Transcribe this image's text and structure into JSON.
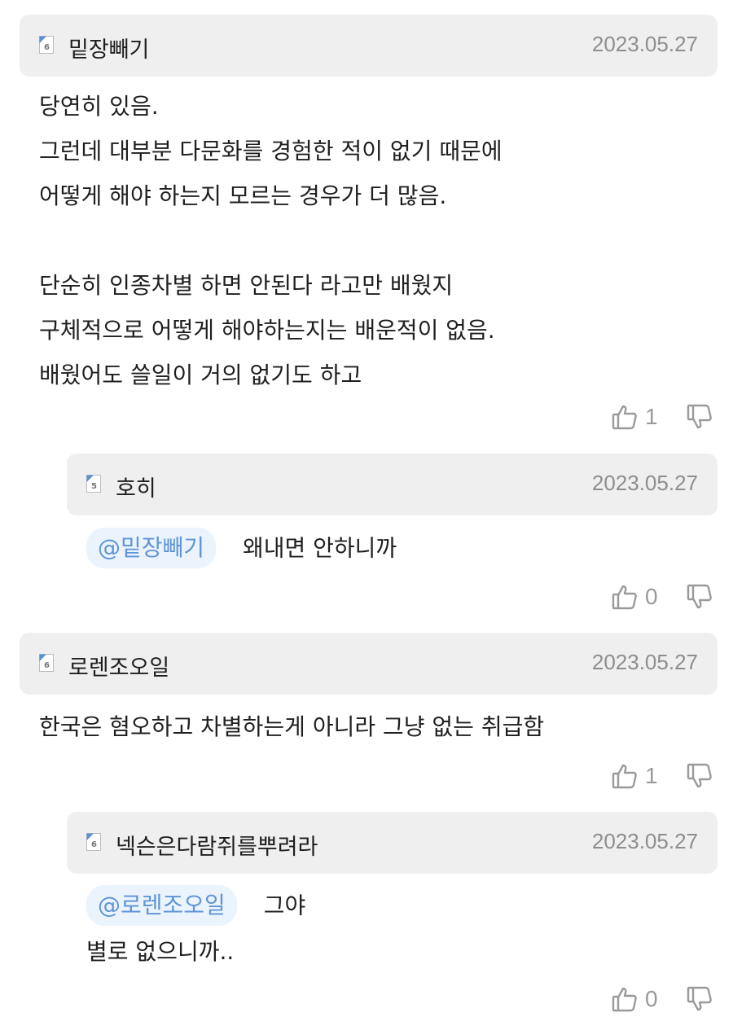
{
  "comments": [
    {
      "author": "밑장빼기",
      "level": "6",
      "date": "2023.05.27",
      "lines": [
        "당연히 있음.",
        "그런데 대부분 다문화를 경험한 적이 없기 때문에",
        "어떻게 해야 하는지 모르는 경우가 더 많음.",
        "",
        "단순히 인종차별 하면 안된다 라고만 배웠지",
        "구체적으로 어떻게 해야하는지는 배운적이 없음.",
        "배웠어도 쓸일이 거의 없기도 하고"
      ],
      "likes": "1"
    },
    {
      "author": "호히",
      "level": "5",
      "date": "2023.05.27",
      "mention": "@밑장빼기",
      "lines": [
        "왜내면 안하니까"
      ],
      "likes": "0"
    },
    {
      "author": "로렌조오일",
      "level": "6",
      "date": "2023.05.27",
      "lines": [
        "한국은 혐오하고 차별하는게 아니라 그냥 없는 취급함"
      ],
      "likes": "1"
    },
    {
      "author": "넥슨은다람쥐를뿌려라",
      "level": "6",
      "date": "2023.05.27",
      "mention": "@로렌조오일",
      "lines": [
        "그야",
        "별로 없으니까.."
      ],
      "likes": "0"
    }
  ],
  "icons": {
    "like": "thumbs-up-outline-icon",
    "dislike": "thumbs-down-outline-icon",
    "level": "level-badge-icon"
  },
  "colors": {
    "header_bg": "#efefef",
    "mention_bg": "#ebf3fd",
    "mention_text": "#5f94d6",
    "date_text": "#8e8e8e",
    "icon_gray": "#9a9a9a",
    "badge_blue": "#5b8fd6"
  }
}
